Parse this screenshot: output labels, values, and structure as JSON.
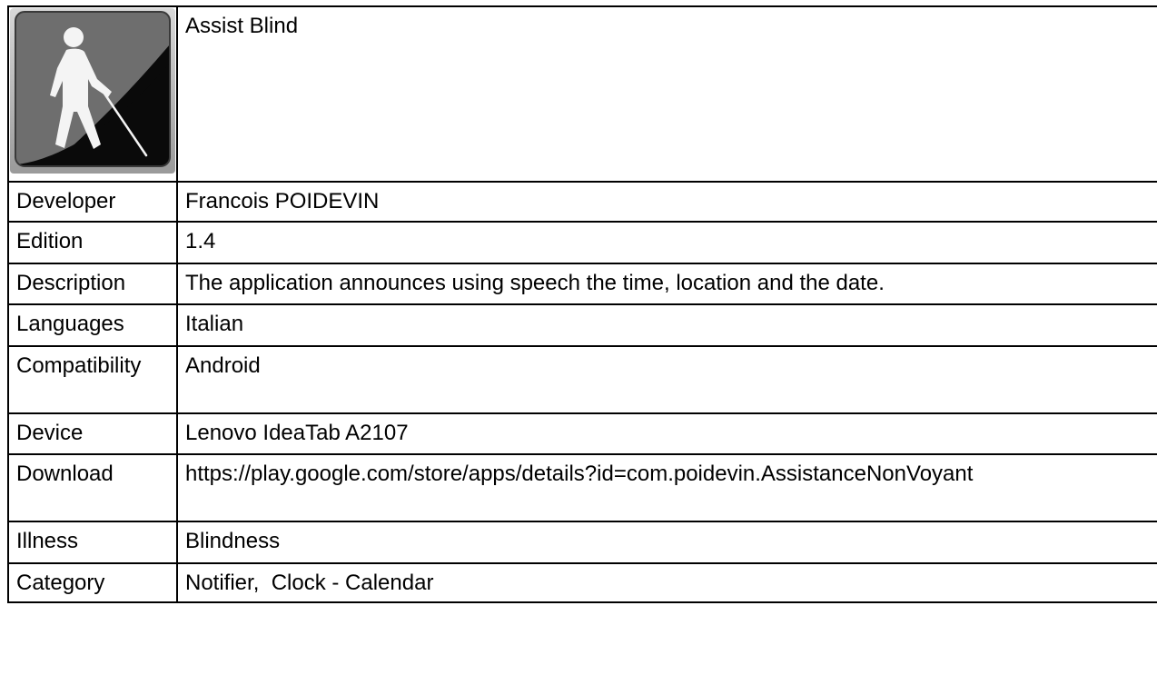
{
  "app": {
    "name": "Assist Blind",
    "icon": "blind-person-with-cane-icon"
  },
  "rows": [
    {
      "label": "Developer",
      "value": "Francois POIDEVIN"
    },
    {
      "label": "Edition",
      "value": "1.4"
    },
    {
      "label": "Description",
      "value": "The application announces using speech the time, location and the date."
    },
    {
      "label": "Languages",
      "value": "Italian"
    },
    {
      "label": "Compatibility",
      "value": "Android"
    },
    {
      "label": "Device",
      "value": "Lenovo IdeaTab A2107"
    },
    {
      "label": "Download",
      "value": "https://play.google.com/store/apps/details?id=com.poidevin.AssistanceNonVoyant"
    },
    {
      "label": "Illness",
      "value": "Blindness"
    },
    {
      "label": "Category",
      "value": "Notifier,  Clock - Calendar"
    }
  ]
}
